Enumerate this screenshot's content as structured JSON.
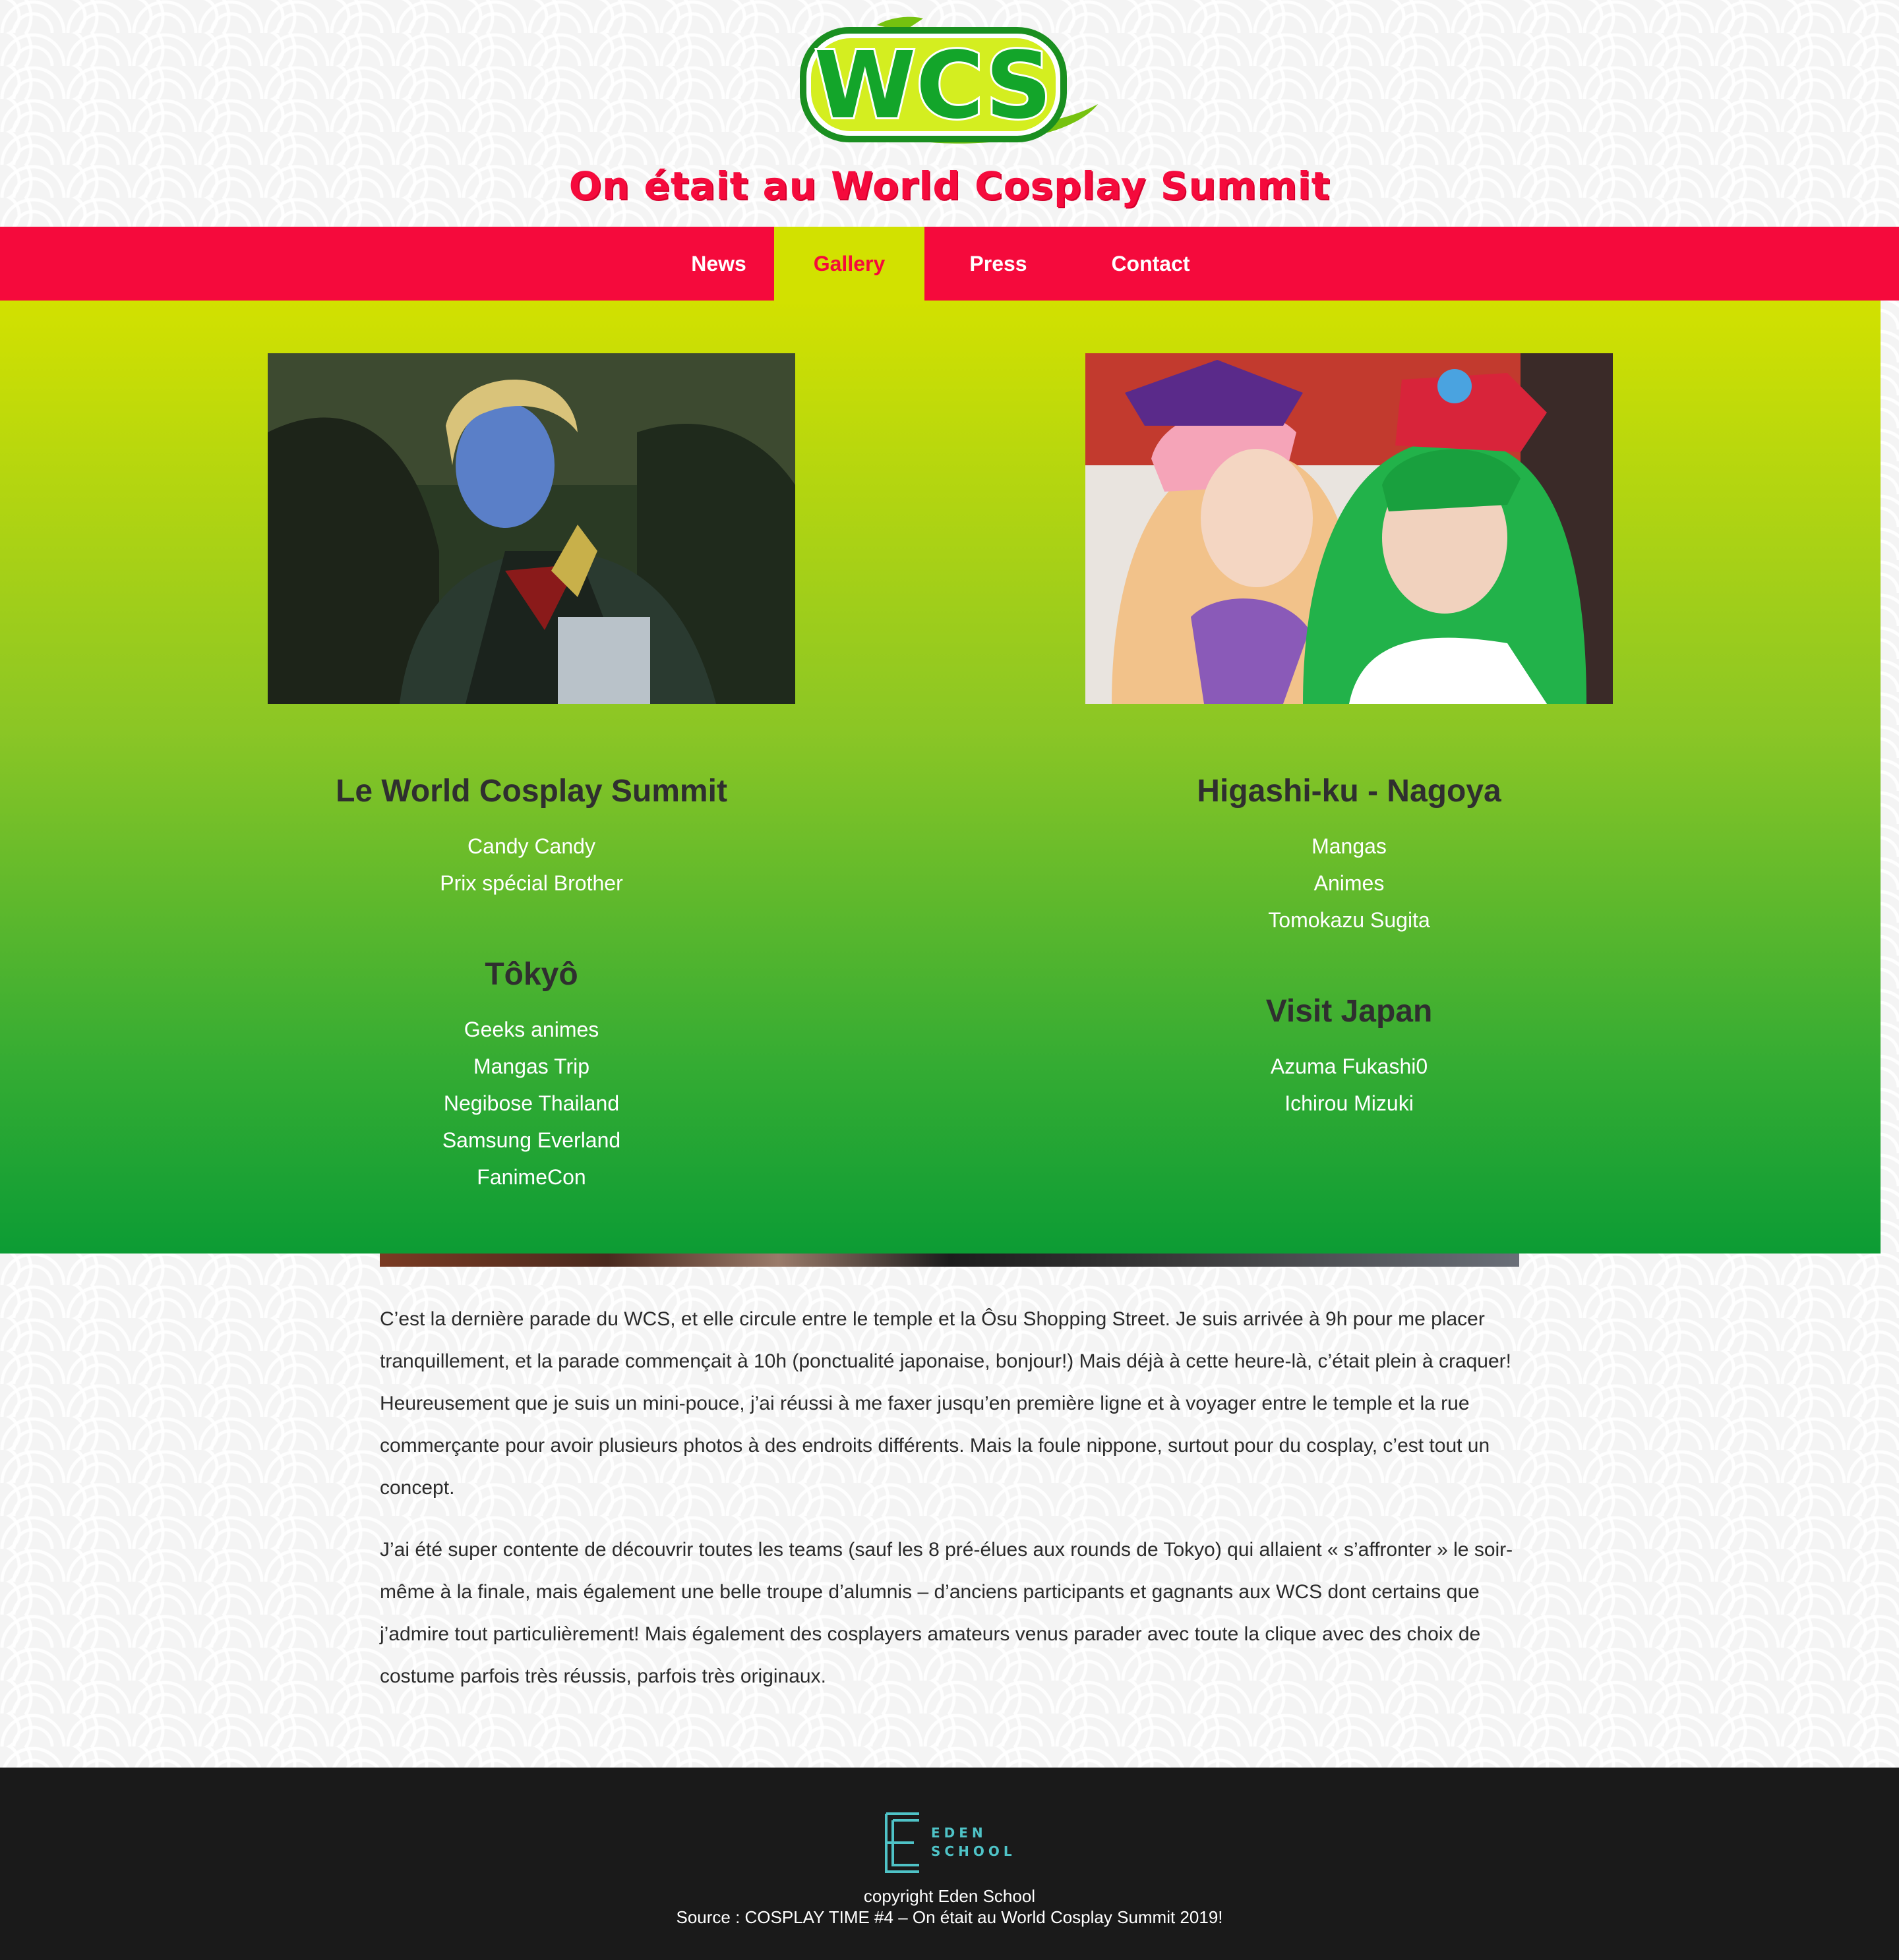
{
  "site": {
    "logo_text": "WCS",
    "title": "On était au World Cosplay Summit"
  },
  "nav": {
    "items": [
      {
        "label": "News",
        "active": false
      },
      {
        "label": "Gallery",
        "active": true
      },
      {
        "label": "Press",
        "active": false
      },
      {
        "label": "Contact",
        "active": false
      }
    ]
  },
  "gallery": {
    "left": {
      "photo_alt": "cosplayer with blue face paint",
      "sections": [
        {
          "heading": "Le World Cosplay Summit",
          "items": [
            "Candy Candy",
            "Prix spécial Brother"
          ]
        },
        {
          "heading": "Tôkyô",
          "items": [
            "Geeks animes",
            "Mangas Trip",
            "Negibose Thailand",
            "Samsung Everland",
            "FanimeCon"
          ]
        }
      ]
    },
    "right": {
      "photo_alt": "two cosplayers with pink and green wigs",
      "sections": [
        {
          "heading": "Higashi-ku - Nagoya",
          "items": [
            "Mangas",
            "Animes",
            "Tomokazu Sugita"
          ]
        },
        {
          "heading": "Visit Japan",
          "items": [
            "Azuma Fukashi0",
            "Ichirou Mizuki"
          ]
        }
      ]
    }
  },
  "article": {
    "paragraphs": [
      "C’est la dernière parade du WCS, et elle circule entre le temple et la Ôsu Shopping Street. Je suis arrivée à 9h pour me placer tranquillement, et la parade commençait à 10h (ponctualité japonaise, bonjour!) Mais déjà à cette heure-là, c’était plein à craquer! Heureusement que je suis un mini-pouce, j’ai réussi à me faxer jusqu’en première ligne et à voyager entre le temple et la rue commerçante pour avoir plusieurs photos à des endroits différents. Mais la foule nippone, surtout pour du cosplay, c’est tout un concept.",
      "J’ai été super contente de découvrir toutes les teams (sauf les 8 pré-élues aux rounds de Tokyo) qui allaient « s’affronter » le soir-même à la finale, mais également une belle troupe d’alumnis – d’anciens participants et gagnants aux WCS dont certains que j’admire tout particulièrement! Mais également des cosplayers amateurs venus parader avec toute la clique avec des choix de costume parfois très réussis, parfois très originaux."
    ]
  },
  "footer": {
    "logo_line1": "EDEN",
    "logo_line2": "SCHOOL",
    "copyright": "copyright Eden School",
    "source": "Source : COSPLAY TIME #4 – On était au World Cosplay Summit 2019!"
  },
  "colors": {
    "brand_red": "#f50a3c",
    "lime": "#d2e100",
    "green": "#0c9c34",
    "footer_bg": "#1a1a1a",
    "eden_teal": "#4fc3c7"
  }
}
